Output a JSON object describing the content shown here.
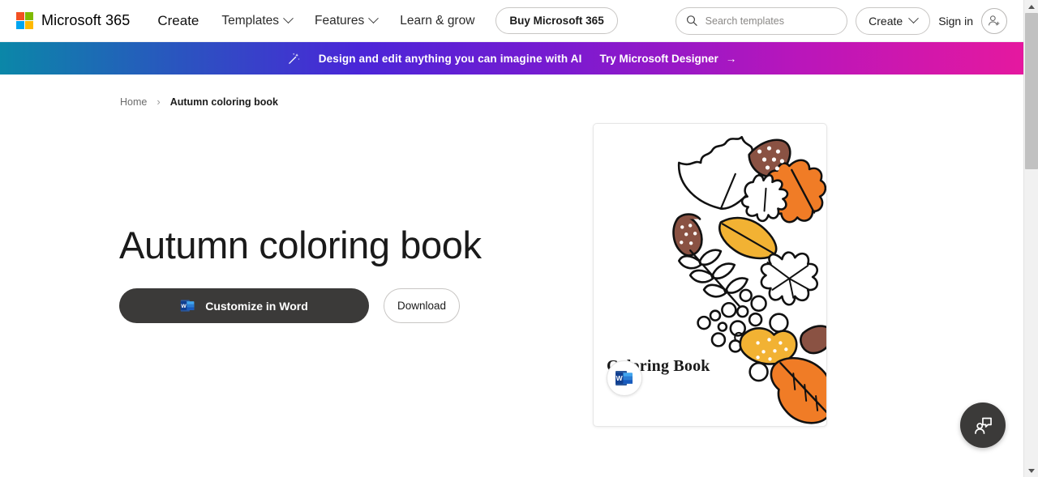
{
  "header": {
    "brand": "Microsoft 365",
    "logo_colors": [
      "#f25022",
      "#7fba00",
      "#00a4ef",
      "#ffb900"
    ],
    "nav": [
      {
        "label": "Create",
        "has_chevron": false
      },
      {
        "label": "Templates",
        "has_chevron": true
      },
      {
        "label": "Features",
        "has_chevron": true
      },
      {
        "label": "Learn & grow",
        "has_chevron": false
      }
    ],
    "buy_button": "Buy Microsoft 365",
    "search_placeholder": "Search templates",
    "search_value": "",
    "create_button": "Create",
    "sign_in": "Sign in",
    "icons": {
      "search": "search-icon",
      "avatar": "person-add-icon",
      "chevron": "chevron-down-icon"
    }
  },
  "banner": {
    "text": "Design and edit anything you can imagine with AI",
    "cta": "Try Microsoft Designer",
    "arrow": "→",
    "icon": "magic-wand-icon",
    "gradient_start": "#0b87a8",
    "gradient_end": "#e5189f"
  },
  "breadcrumb": {
    "home": "Home",
    "separator": "›",
    "current": "Autumn coloring book"
  },
  "hero": {
    "title": "Autumn coloring book",
    "primary_button": "Customize in Word",
    "primary_button_icon": "word-icon",
    "secondary_button": "Download",
    "primary_bg": "#3b3a39"
  },
  "preview": {
    "cover_title": "Coloring Book",
    "badge_icon": "word-icon",
    "illustration": "autumn-leaves-coloring-page",
    "colors": {
      "orange": "#f07c26",
      "gold": "#f2b233",
      "brown": "#8a5243",
      "outline": "#111111"
    }
  },
  "feedback": {
    "label": "feedback-button",
    "icon": "person-speech-bubble-icon"
  },
  "scrollbar": {
    "up_arrow": "▲",
    "down_arrow": "▼"
  }
}
